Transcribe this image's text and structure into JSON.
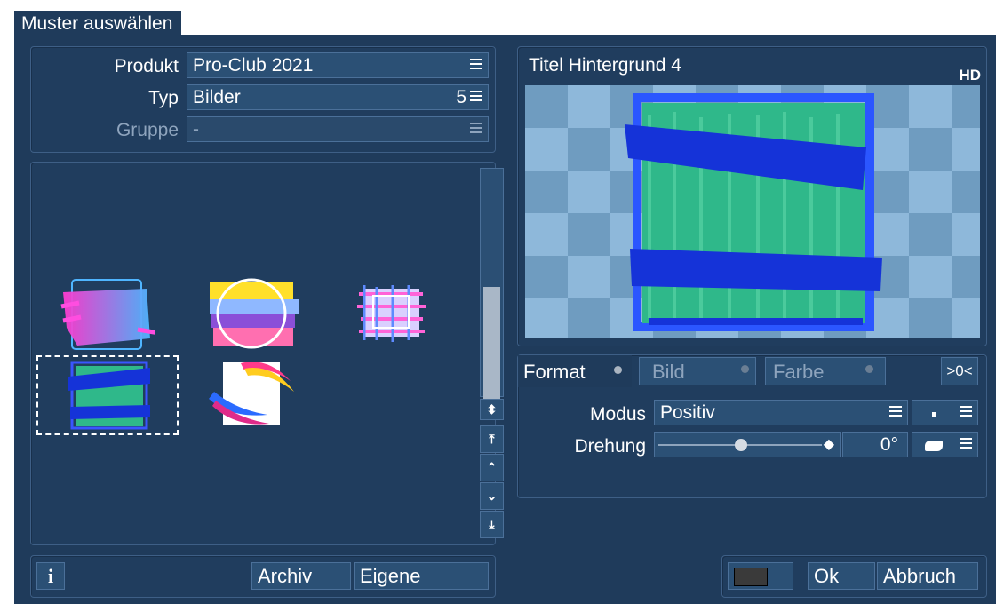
{
  "dialog": {
    "title": "Muster auswählen"
  },
  "left": {
    "rows": [
      {
        "label": "Produkt",
        "value": "Pro-Club 2021",
        "count": ""
      },
      {
        "label": "Typ",
        "value": "Bilder",
        "count": "5"
      },
      {
        "label": "Gruppe",
        "value": "-",
        "count": ""
      }
    ],
    "thumbnails": [
      "pink-brush",
      "tricolor-circle",
      "glitch-frame",
      "title-background-4",
      "color-swoosh"
    ],
    "buttons": {
      "info": "i",
      "archiv": "Archiv",
      "eigene": "Eigene"
    }
  },
  "preview": {
    "title": "Titel Hintergrund 4",
    "badge": "HD"
  },
  "tabs": [
    {
      "label": "Format",
      "active": true
    },
    {
      "label": "Bild",
      "active": false
    },
    {
      "label": "Farbe",
      "active": false
    }
  ],
  "tab_extra": ">0<",
  "settings": {
    "modus_label": "Modus",
    "modus_value": "Positiv",
    "drehung_label": "Drehung",
    "drehung_value": "0°",
    "drehung_level": 0.5
  },
  "footer": {
    "ok": "Ok",
    "cancel": "Abbruch"
  },
  "colors": {
    "accent": "#1f3b5b",
    "field": "#2b5075",
    "brush_blue": "#1533d8",
    "brush_green": "#2fb88a"
  }
}
